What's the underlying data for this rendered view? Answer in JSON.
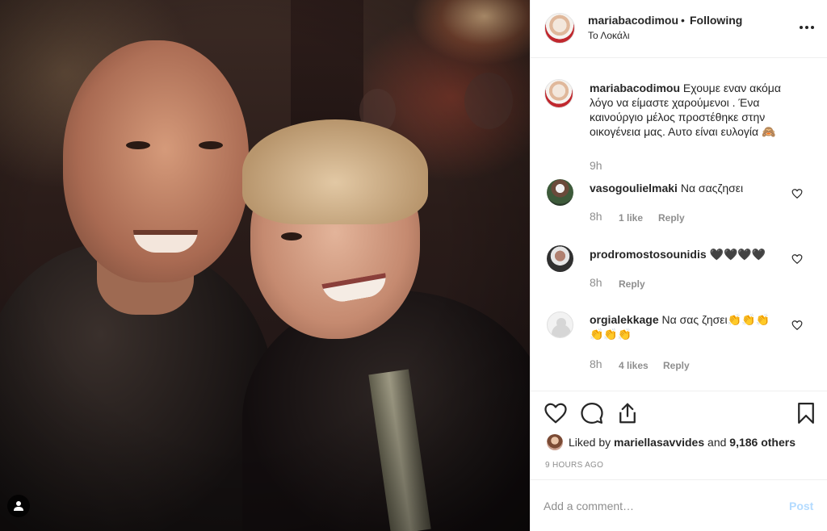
{
  "post": {
    "username": "mariabacodimou",
    "separator": "•",
    "follow_status": "Following",
    "location": "Το Λοκάλι"
  },
  "caption": {
    "username": "mariabacodimou",
    "line1": "Εχουμε εναν ακόμα",
    "line2": "λόγο να είμαστε χαρούμενοι . Ένα",
    "line3": "καινούργιο μέλος προστέθηκε στην",
    "line4": "οικογένεια μας. Αυτο είναι ευλογία 🙈",
    "time": "9h"
  },
  "comments": [
    {
      "username": "vasogoulielmaki",
      "text": "Να σαςζησει",
      "time": "8h",
      "likes": "1 like",
      "reply": "Reply"
    },
    {
      "username": "prodromostosounidis",
      "text": "🖤🖤🖤🖤",
      "time": "8h",
      "reply": "Reply"
    },
    {
      "username": "orgialekkage",
      "text": "Να σας ζησει👏👏👏",
      "text_line2": "👏👏👏",
      "time": "8h",
      "likes": "4 likes",
      "reply": "Reply"
    }
  ],
  "likes": {
    "prefix": "Liked by",
    "liker": "mariellasavvides",
    "joiner": "and",
    "others": "9,186 others"
  },
  "timestamp": "9 HOURS AGO",
  "add_comment": {
    "placeholder": "Add a comment…",
    "post_label": "Post"
  },
  "colors": {
    "text": "#262626",
    "muted": "#8e8e8e",
    "border": "#efefef",
    "post_disabled": "#b3dbff"
  },
  "icons": {
    "like": "heart-icon",
    "comment": "comment-icon",
    "share": "share-icon",
    "save": "bookmark-icon",
    "more": "more-options-icon",
    "tag": "user-tag-icon"
  }
}
